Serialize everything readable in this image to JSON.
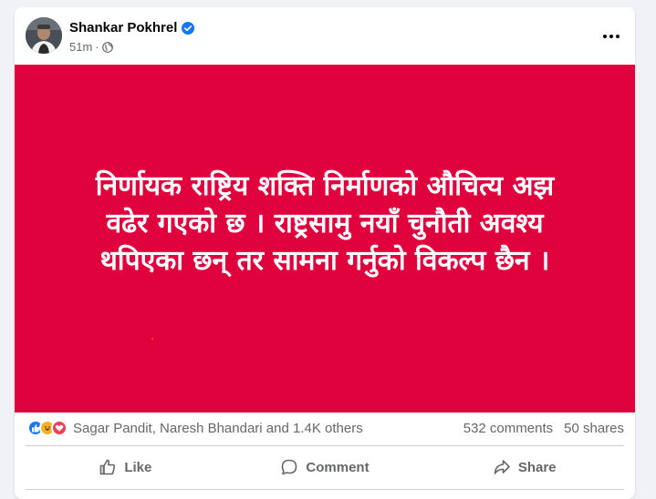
{
  "post": {
    "author": "Shankar Pokhrel",
    "time": "51m",
    "separator": "·",
    "verified": true,
    "privacy_icon": "globe-icon",
    "more_icon": "ellipsis-icon",
    "image": {
      "background": "#e0023d",
      "lines": [
        "निर्णायक राष्ट्रिय शक्ति निर्माणको औचित्य अझ",
        "वढेर गएको छ । राष्ट्रसामु नयाँ चुनौती अवश्य",
        "थपिएका छन् तर सामना गर्नुको विकल्प छैन ।"
      ]
    }
  },
  "stats": {
    "reaction_icons": [
      "like-reaction-icon",
      "haha-reaction-icon",
      "love-reaction-icon"
    ],
    "reactors": "Sagar Pandit, Naresh Bhandari and 1.4K others",
    "comments": "532 comments",
    "shares": "50 shares"
  },
  "actions": {
    "like": "Like",
    "comment": "Comment",
    "share": "Share"
  },
  "colors": {
    "accent": "#1877f2",
    "post_bg": "#e0023d"
  }
}
